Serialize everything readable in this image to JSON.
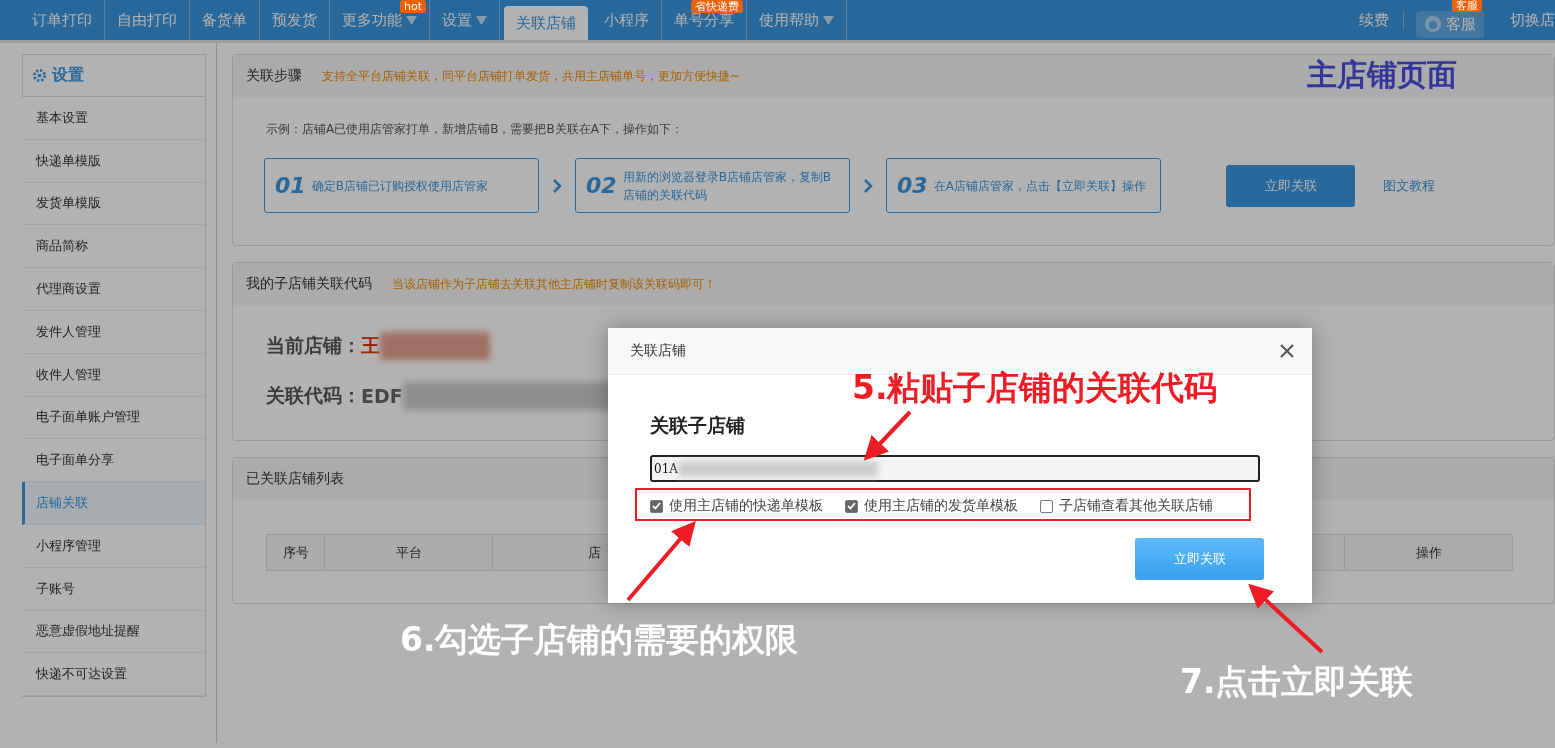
{
  "nav": {
    "items": [
      {
        "label": "订单打印",
        "selected": false,
        "dropdown": false
      },
      {
        "label": "自由打印",
        "selected": false,
        "dropdown": false
      },
      {
        "label": "备货单",
        "selected": false,
        "dropdown": false
      },
      {
        "label": "预发货",
        "selected": false,
        "dropdown": false
      },
      {
        "label": "更多功能",
        "selected": false,
        "dropdown": true,
        "badge": "hot"
      },
      {
        "label": "设置",
        "selected": false,
        "dropdown": true
      },
      {
        "label": "关联店铺",
        "selected": true,
        "dropdown": false
      },
      {
        "label": "小程序",
        "selected": false,
        "dropdown": false
      },
      {
        "label": "单号分享",
        "selected": false,
        "dropdown": false,
        "badge": "省快递费"
      },
      {
        "label": "使用帮助",
        "selected": false,
        "dropdown": true
      }
    ],
    "right": {
      "renew": "续费",
      "service": "客服",
      "service_badge": "客服",
      "switch": "切换店"
    }
  },
  "sidebar": {
    "title": "设置",
    "items": [
      {
        "label": "基本设置",
        "selected": false
      },
      {
        "label": "快递单模版",
        "selected": false
      },
      {
        "label": "发货单模版",
        "selected": false
      },
      {
        "label": "商品简称",
        "selected": false
      },
      {
        "label": "代理商设置",
        "selected": false
      },
      {
        "label": "发件人管理",
        "selected": false
      },
      {
        "label": "收件人管理",
        "selected": false
      },
      {
        "label": "电子面单账户管理",
        "selected": false
      },
      {
        "label": "电子面单分享",
        "selected": false
      },
      {
        "label": "店铺关联",
        "selected": true
      },
      {
        "label": "小程序管理",
        "selected": false
      },
      {
        "label": "子账号",
        "selected": false
      },
      {
        "label": "恶意虚假地址提醒",
        "selected": false
      },
      {
        "label": "快递不可达设置",
        "selected": false
      }
    ]
  },
  "steps_panel": {
    "title": "关联步骤",
    "hint": "支持全平台店铺关联，同平台店铺打单发货，共用主店铺单号，更加方便快捷~",
    "page_label": "主店铺页面",
    "example": "示例：店铺A已使用店管家打单，新增店铺B，需要把B关联在A下，操作如下：",
    "steps": [
      {
        "number": "01",
        "text": "确定B店铺已订购授权使用店管家"
      },
      {
        "number": "02",
        "text": "用新的浏览器登录B店铺店管家，复制B店铺的关联代码"
      },
      {
        "number": "03",
        "text": "在A店铺店管家，点击【立即关联】操作"
      }
    ],
    "button": "立即关联",
    "link": "图文教程"
  },
  "code_panel": {
    "title": "我的子店铺关联代码",
    "hint": "当该店铺作为子店铺去关联其他主店铺时复制该关联码即可！",
    "shop_label": "当前店铺：",
    "shop_value": "王",
    "code_label": "关联代码：",
    "code_value": "EDF"
  },
  "list_panel": {
    "title": "已关联店铺列表",
    "columns": [
      "序号",
      "平台",
      "店",
      "操作"
    ]
  },
  "dialog": {
    "title": "关联店铺",
    "field_label": "关联子店铺",
    "value": "01A",
    "options": [
      {
        "label": "使用主店铺的快递单模板",
        "checked": true
      },
      {
        "label": "使用主店铺的发货单模板",
        "checked": true
      },
      {
        "label": "子店铺查看其他关联店铺",
        "checked": false
      }
    ],
    "button": "立即关联"
  },
  "annotations": [
    "5.粘贴子店铺的关联代码",
    "6.勾选子店铺的需要的权限",
    "7.点击立即关联"
  ]
}
